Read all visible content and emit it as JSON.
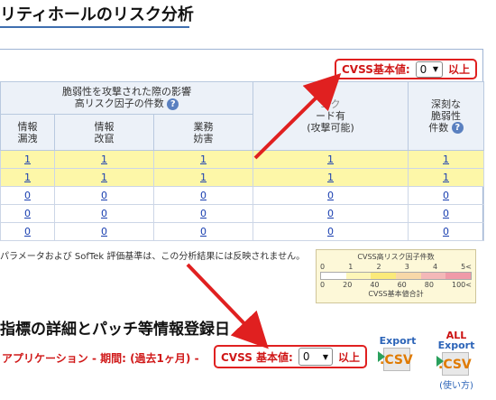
{
  "page_title": "リティホールのリスク分析",
  "cvss_top": {
    "label": "CVSS基本値:",
    "value": "0",
    "suffix": "以上"
  },
  "table": {
    "group_header": "脆弱性を攻撃された際の影響",
    "group_header2": "高リスク因子の件数",
    "col_exploit": "エクスプロイトコード有(攻撃可能)",
    "col_exploit_line2": "ード有",
    "col_exploit_line3": "(攻撃可能)",
    "col_severe": [
      "深刻な",
      "脆弱性",
      "件数"
    ],
    "sub_cols": [
      [
        "情報",
        "漏洩"
      ],
      [
        "情報",
        "改竄"
      ],
      [
        "業務",
        "妨害"
      ]
    ],
    "rows": [
      {
        "highlight": true,
        "cells": [
          "1",
          "1",
          "1",
          "1",
          "1"
        ]
      },
      {
        "highlight": true,
        "cells": [
          "1",
          "1",
          "1",
          "1",
          "1"
        ]
      },
      {
        "highlight": false,
        "cells": [
          "0",
          "0",
          "0",
          "0",
          "0"
        ]
      },
      {
        "highlight": false,
        "cells": [
          "0",
          "0",
          "0",
          "0",
          "0"
        ]
      },
      {
        "highlight": false,
        "cells": [
          "0",
          "0",
          "0",
          "0",
          "0"
        ]
      }
    ]
  },
  "note": "パラメータおよび SofTek 評価基準は、この分析結果には反映されません。",
  "legend": {
    "title": "CVSS高リスク因子件数",
    "top_scale": [
      "0",
      "1",
      "2",
      "3",
      "4",
      "5<"
    ],
    "bottom_scale": [
      "0",
      "20",
      "40",
      "60",
      "80",
      "100<"
    ],
    "footer": "CVSS基本値合計",
    "colors": [
      "#ffffff",
      "#fdf6b8",
      "#fbea7a",
      "#f8d8a8",
      "#f4b8b8",
      "#f09aa8"
    ]
  },
  "subheading": "指標の詳細とパッチ等情報登録日",
  "app_line": "アプリケーション - 期間: (過去1ヶ月) -",
  "cvss_bottom": {
    "label": "CVSS 基本値:",
    "value": "0",
    "suffix": "以上"
  },
  "export": {
    "label": "Export",
    "ext": ".CSV"
  },
  "export_all": {
    "top": "ALL",
    "label": "Export",
    "ext": ".CSV",
    "usage": "(使い方)"
  },
  "colors": {
    "accent_red": "#e02020",
    "link_blue": "#1a3fb0",
    "highlight_row": "#fdf7a8"
  }
}
